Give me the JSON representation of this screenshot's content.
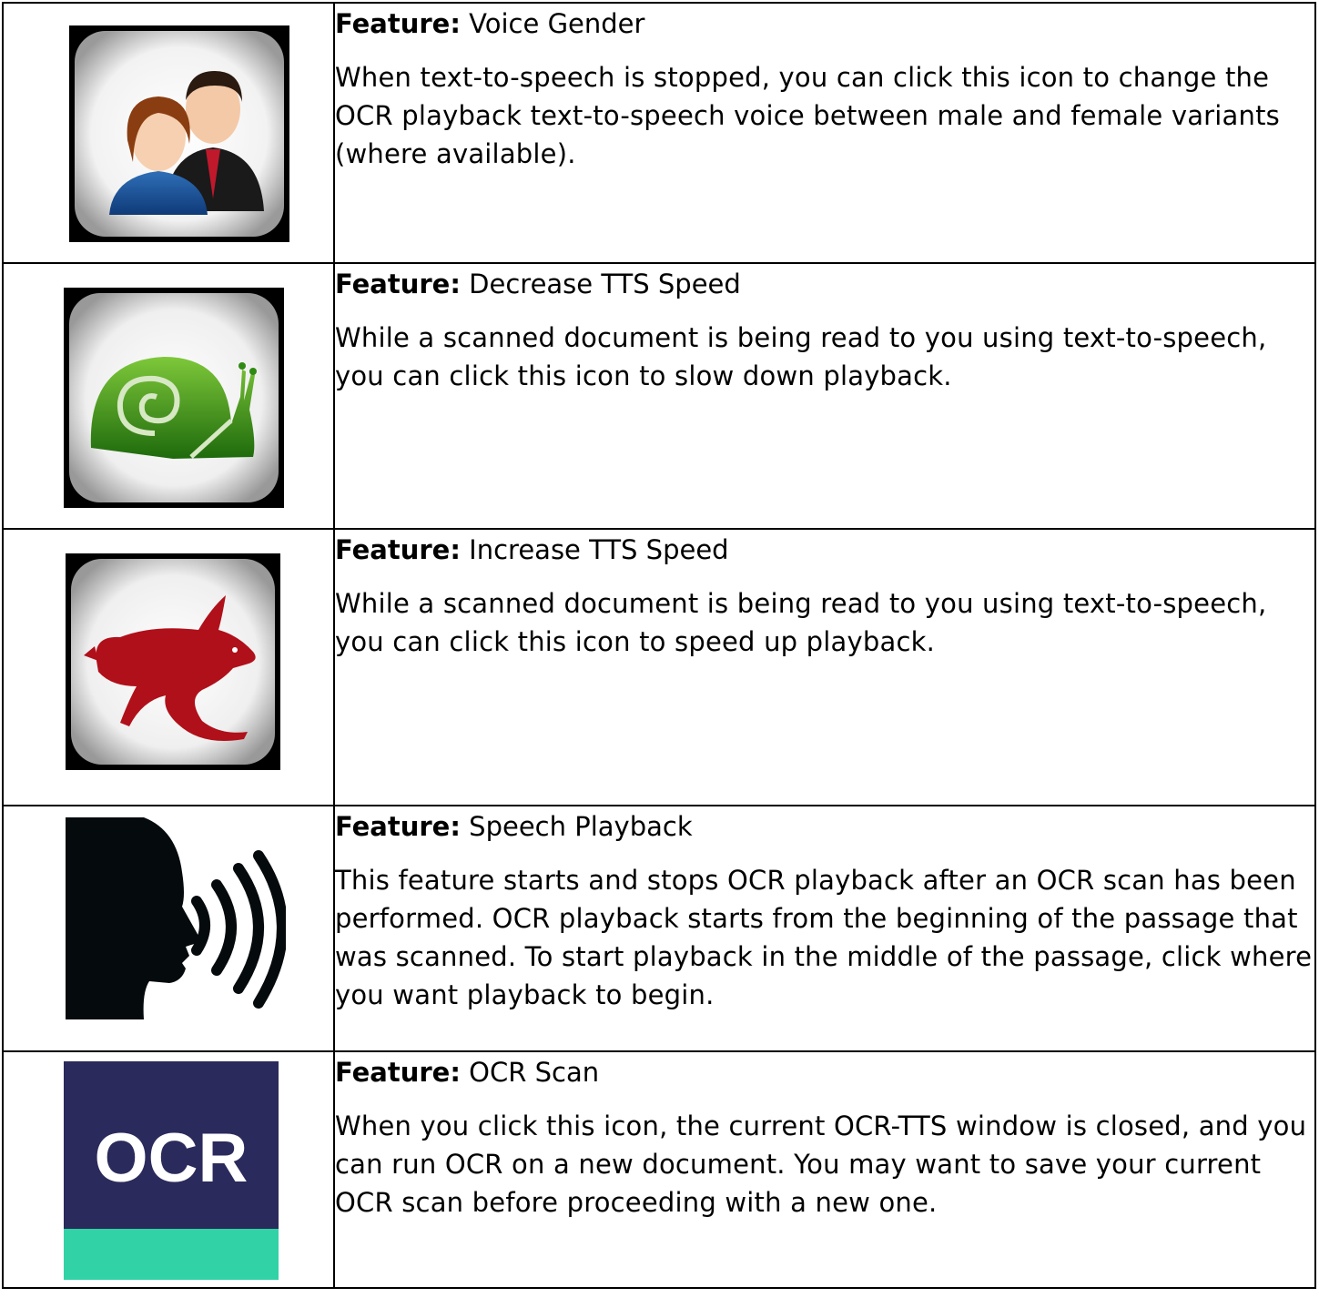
{
  "feature_prefix": "Feature:",
  "rows": [
    {
      "icon": "voice-gender-icon",
      "name": "Voice Gender",
      "description": "When text-to-speech is stopped, you can click this icon to change the OCR playback text-to-speech voice between male and female variants (where available)."
    },
    {
      "icon": "snail-icon",
      "name": "Decrease TTS Speed",
      "description": "While a scanned document is being read to you using text-to-speech, you can click this icon to slow down playback."
    },
    {
      "icon": "rabbit-icon",
      "name": "Increase TTS Speed",
      "description": "While a scanned document is being read to you using text-to-speech, you can click this icon to speed up playback."
    },
    {
      "icon": "speaking-head-icon",
      "name": "Speech Playback",
      "description": "This feature starts and stops OCR playback after an OCR scan has been performed. OCR playback starts from the beginning of the passage that was scanned. To start playback in the middle of the passage, click where you want playback to begin."
    },
    {
      "icon": "ocr-icon",
      "icon_text": "OCR",
      "name": "OCR Scan",
      "description": "When you click this icon, the current OCR-TTS window is closed, and you can run OCR on a new document. You may want to save your current OCR scan before proceeding with a new one."
    }
  ],
  "colors": {
    "snail_green": "#2f8a12",
    "rabbit_red": "#b0101a",
    "ocr_navy": "#2b2a5c",
    "ocr_teal": "#31d3a6"
  }
}
